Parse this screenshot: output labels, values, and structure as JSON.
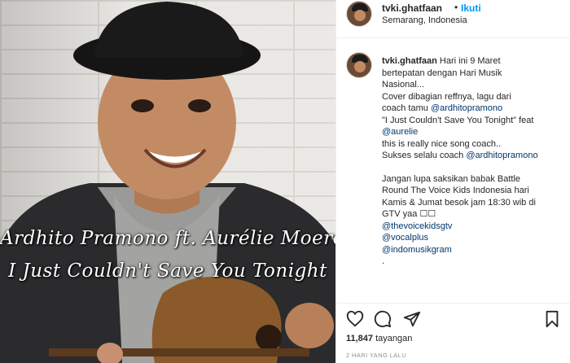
{
  "media": {
    "caption_line1": "Ardhito Pramono ft. Aurélie Moeremans",
    "caption_line2": "I Just Couldn't Save You Tonight"
  },
  "header": {
    "username": "tvki.ghatfaan",
    "separator": "•",
    "follow_label": "Ikuti",
    "location": "Semarang, Indonesia"
  },
  "post": {
    "username": "tvki.ghatfaan",
    "lines": [
      "Hari ini 9 Maret",
      "bertepatan dengan Hari Musik",
      "Nasional...",
      "Cover dibagian reffnya, lagu dari",
      "coach tamu",
      "\"I Just Couldn't Save You Tonight\" feat",
      "this is really nice song coach..",
      "Sukses selalu coach",
      "Jangan lupa saksikan babak Battle",
      "Round The Voice Kids Indonesia hari",
      "Kamis & Jumat besok jam 18:30 wib di",
      "GTV yaa ☐☐",
      "."
    ],
    "mentions": {
      "ardhito1": "@ardhitopramono",
      "aurelie": "@aurelie",
      "ardhito2": "@ardhitopramono",
      "thevoicekids": "@thevoicekidsgtv",
      "vocalplus": "@vocalplus",
      "indomusik": "@indomusikgram"
    }
  },
  "stats": {
    "views_count": "11,847",
    "views_label": "tayangan",
    "time_ago": "2 HARI YANG LALU"
  },
  "icons": {
    "like": "heart-icon",
    "comment": "comment-icon",
    "share": "paper-plane-icon",
    "save": "bookmark-icon"
  }
}
